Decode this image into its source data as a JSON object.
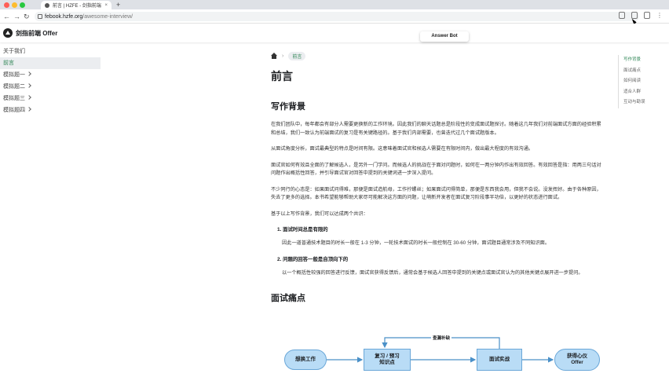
{
  "browser": {
    "tab_title": "前言 | HZFE - 剑指前端 Offer",
    "tab_close": "×",
    "new_tab": "+",
    "nav_back": "←",
    "nav_forward": "→",
    "nav_reload": "↻",
    "url_host": "febook.hzfe.org",
    "url_path": "/awesome-interview/",
    "menu_dots": "⋮"
  },
  "navbar": {
    "brand": "剑指前端 Offer",
    "answer_bot": "Answer Bot"
  },
  "sidebar": {
    "items": [
      {
        "label": "关于我们",
        "active": false,
        "chevron": false
      },
      {
        "label": "前言",
        "active": true,
        "chevron": false
      },
      {
        "label": "模拟题一",
        "active": false,
        "chevron": true
      },
      {
        "label": "模拟题二",
        "active": false,
        "chevron": true
      },
      {
        "label": "模拟题三",
        "active": false,
        "chevron": true
      },
      {
        "label": "模拟题四",
        "active": false,
        "chevron": true
      }
    ]
  },
  "breadcrumb": {
    "separator": "›",
    "current": "前言"
  },
  "content": {
    "title": "前言",
    "h2_background": "写作背景",
    "p1": "在我们团队中，每年都会有部分人需要更换新的工作环境。因此我们的聊天话题总是阶段性的变成面试题探讨。随着这几年我们对前端面试方面的经验积累和总结，我们一致认为前端面试的复习是有关键路径的。基于我们内部需要，也曾迭代过几个面试题版本。",
    "p2": "从面试角度分析，面试最典型的特点是时间有限。这意味着面试官和候选人需要在有限时间内，做出最大程度的有效沟通。",
    "p3": "面试官如何有效且全面的了解候选人，是另外一门学问。而候选人的挑战在于面对问题时，如何在一两分钟内作出有效回答。有效回答是指：用两三句话对问题作出概括性回答，并引导面试官对回答中提到的关键词进一步深入提问。",
    "p4": "不少同行的心态是：如果面试问得难，那便是面试造航母，工作拧螺丝；如果面试问得简单，那便是东西我会用，但我不会说。没发挥好。由于各种原因，失去了更多的选择。本书希望能够帮助大家尽可能解决这方面的问题，让萌新开发者在面试复习阶段事半功倍，以更好的状态进行面试。",
    "p5": "基于以上写作背景，我们可以达成两个共识：",
    "item1_title": "1.  面试时间总是有限的",
    "item1_desc": "因此一道普通技术题目的时长一般在 1-3 分钟，一轮技术面试的时长一般控制在 30-60 分钟，面试题目通常涉及不同知识面。",
    "item2_title": "2.  问题的回答一般是自顶向下的",
    "item2_desc": "以一个概括性较强的回答进行反馈，面试官获得反馈后，通常会基于候选人回答中提到的关键点或面试官认为的其他关键点展开进一步提问。",
    "h2_pain": "面试痛点"
  },
  "toc": {
    "items": [
      {
        "label": "写作背景",
        "active": true
      },
      {
        "label": "面试痛点",
        "active": false
      },
      {
        "label": "如何阅读",
        "active": false
      },
      {
        "label": "适合人群",
        "active": false
      },
      {
        "label": "互动与勘误",
        "active": false
      }
    ]
  },
  "flowchart": {
    "nodes": [
      "想换工作",
      "复习 / 预习\n知识点",
      "面试实战",
      "获得心仪\nOffer"
    ],
    "loop_label": "查漏补缺",
    "colors": {
      "node_fill": "#b9dcf6",
      "node_border": "#6aa7d8",
      "arrow": "#4a90c8"
    }
  },
  "theme": {
    "accent": "#2e8555"
  }
}
